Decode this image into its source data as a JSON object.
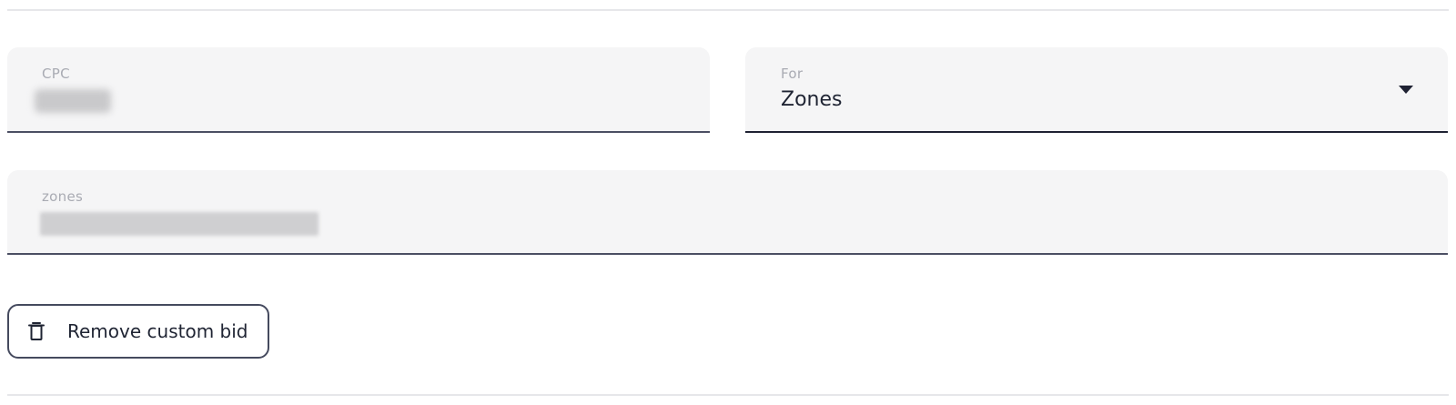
{
  "form": {
    "cpc": {
      "label": "CPC",
      "value_redacted": true
    },
    "for": {
      "label": "For",
      "value": "Zones",
      "icon": "caret-down-icon"
    },
    "zones": {
      "label": "zones",
      "value_redacted": true
    }
  },
  "actions": {
    "remove_label": "Remove custom bid",
    "remove_icon": "trash-icon"
  },
  "colors": {
    "field_bg": "#f5f5f6",
    "underline": "#4b4f63",
    "text": "#1f2433",
    "label": "#a9abb3",
    "divider": "#e6e7ea"
  }
}
